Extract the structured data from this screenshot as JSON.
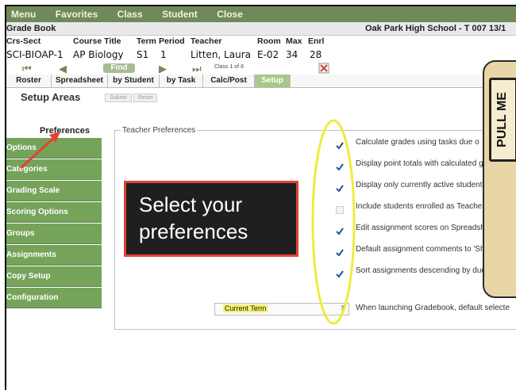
{
  "menu": {
    "items": [
      "Menu",
      "Favorites",
      "Class",
      "Student",
      "Close"
    ]
  },
  "header": {
    "title": "Grade Book",
    "school": "Oak Park High School - T 007 13/1"
  },
  "course": {
    "headers": [
      "Crs-Sect",
      "Course Title",
      "Term",
      "Period",
      "Teacher",
      "Room",
      "Max",
      "Enrl"
    ],
    "values": [
      "SCI-BIOAP-1",
      "AP Biology",
      "S1",
      "1",
      "Litten, Laura",
      "E-02",
      "34",
      "28"
    ]
  },
  "nav": {
    "find_label": "Find",
    "class_of": "Class 1 of 6"
  },
  "tabs": [
    {
      "label": "Roster",
      "active": false
    },
    {
      "label": "Spreadsheet",
      "active": false
    },
    {
      "label": "by Student",
      "active": false
    },
    {
      "label": "by Task",
      "active": false
    },
    {
      "label": "Calc/Post",
      "active": false
    },
    {
      "label": "Setup",
      "active": true
    }
  ],
  "setup": {
    "title": "Setup Areas",
    "submit_label": "Submit",
    "reset_label": "Reset"
  },
  "sidebar": {
    "active": "Preferences",
    "items": [
      "Options",
      "Categories",
      "Grading Scale",
      "Scoring Options",
      "Groups",
      "Assignments",
      "Copy Setup",
      "Configuration"
    ]
  },
  "preferences": {
    "legend": "Teacher Preferences",
    "options": [
      {
        "text": "Calculate grades using tasks due o",
        "checked": true
      },
      {
        "text": "Display point totals with calculated grades",
        "checked": true
      },
      {
        "text": "Display only currently active students in r",
        "checked": true
      },
      {
        "text": "Include students enrolled as Teacher Assi",
        "checked": false
      },
      {
        "text": "Edit assignment scores on Spreadsheet Ta",
        "checked": true
      },
      {
        "text": "Default assignment comments to 'Shared",
        "checked": true
      },
      {
        "text": "Sort assignments descending by due date",
        "checked": true
      },
      {
        "text": "When launching Gradebook, default selecte",
        "checked": false
      }
    ],
    "term_select": "Current Term"
  },
  "annotation": {
    "line1": "Select your",
    "line2": "preferences"
  },
  "pull_tab": {
    "text": "PULL ME"
  },
  "colors": {
    "menu_bar": "#6f8a58",
    "sidebar": "#76a35a",
    "active_tab": "#a8c88a",
    "callout_border": "#e24335",
    "highlight_ellipse": "#f0ec3c"
  }
}
